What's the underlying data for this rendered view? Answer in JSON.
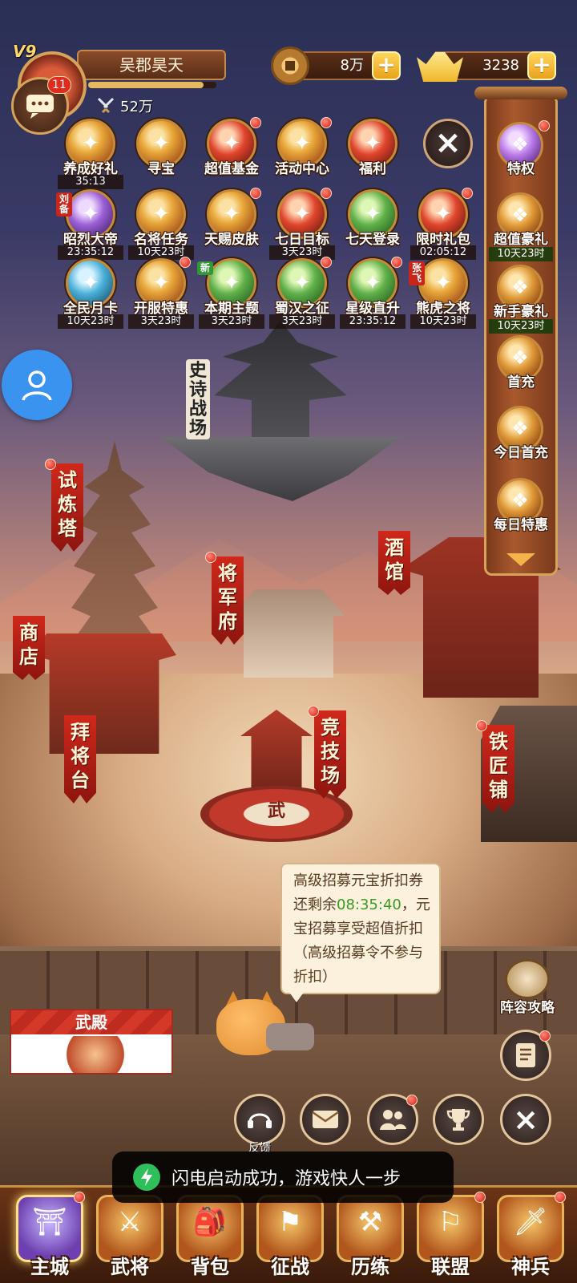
{
  "player": {
    "vip": "V9",
    "name": "吴郡昊天",
    "power": "52万",
    "exp_fraction": 0.9,
    "chat_badge": "11"
  },
  "currency": {
    "copper": "8万",
    "gold": "3238"
  },
  "activities": [
    {
      "label": "养成好礼",
      "timer": "35:13",
      "icon": "gift-icon",
      "color": "orange"
    },
    {
      "label": "寻宝",
      "timer": "",
      "icon": "compass-icon",
      "color": "orange"
    },
    {
      "label": "超值基金",
      "timer": "",
      "icon": "fund-icon",
      "color": "red"
    },
    {
      "label": "活动中心",
      "timer": "",
      "icon": "chest-icon",
      "color": "orange"
    },
    {
      "label": "福利",
      "timer": "",
      "icon": "welfare-icon",
      "color": "red"
    },
    {
      "label": "昭烈大帝",
      "timer": "23:35:12",
      "icon": "hero-icon",
      "color": "purple",
      "tag": "刘备"
    },
    {
      "label": "名将任务",
      "timer": "10天23时",
      "icon": "scroll-icon",
      "color": "orange"
    },
    {
      "label": "天赐皮肤",
      "timer": "",
      "icon": "skin-icon",
      "color": "orange"
    },
    {
      "label": "七日目标",
      "timer": "3天23时",
      "icon": "gift-box-icon",
      "color": "red"
    },
    {
      "label": "七天登录",
      "timer": "",
      "icon": "login-icon",
      "color": "green"
    },
    {
      "label": "限时礼包",
      "timer": "02:05:12",
      "icon": "limited-gift-icon",
      "color": "red"
    },
    {
      "label": "全民月卡",
      "timer": "10天23时",
      "icon": "month-card-icon",
      "color": "blue"
    },
    {
      "label": "开服特惠",
      "timer": "3天23时",
      "icon": "sale-icon",
      "color": "orange"
    },
    {
      "label": "本期主题",
      "timer": "3天23时",
      "icon": "theme-icon",
      "color": "green",
      "tag": "新"
    },
    {
      "label": "蜀汉之征",
      "timer": "3天23时",
      "icon": "crossed-swords-icon",
      "color": "green"
    },
    {
      "label": "星级直升",
      "timer": "23:35:12",
      "icon": "star-up-icon",
      "color": "green"
    },
    {
      "label": "熊虎之将",
      "timer": "10天23时",
      "icon": "general-icon",
      "color": "orange",
      "tag": "张飞"
    }
  ],
  "side_panel": [
    {
      "label": "特权",
      "timer": "",
      "icon": "privilege-icon"
    },
    {
      "label": "超值豪礼",
      "timer": "10天23时",
      "icon": "deluxe-gift-icon"
    },
    {
      "label": "新手豪礼",
      "timer": "10天23时",
      "icon": "newbie-gift-icon"
    },
    {
      "label": "首充",
      "timer": "",
      "icon": "first-recharge-icon"
    },
    {
      "label": "今日首充",
      "timer": "",
      "icon": "daily-recharge-icon"
    },
    {
      "label": "每日特惠",
      "timer": "",
      "icon": "daily-deal-icon"
    }
  ],
  "map": {
    "epic_battlefield": "史诗战场",
    "buildings": [
      {
        "label": "试炼塔"
      },
      {
        "label": "将军府"
      },
      {
        "label": "酒馆"
      },
      {
        "label": "商店"
      },
      {
        "label": "拜将台"
      },
      {
        "label": "竞技场"
      },
      {
        "label": "铁匠铺"
      }
    ],
    "arena_emblem": "武"
  },
  "tooltip": {
    "line1": "高级招募元宝折扣券",
    "line2_prefix": "还剩余",
    "countdown": "08:35:40",
    "line2_suffix": "，元",
    "line3": "宝招募享受超值折扣",
    "line4": "（高级招募令不参与",
    "line5": "折扣）"
  },
  "wudian": {
    "title": "武殿"
  },
  "guide": {
    "label": "阵容攻略"
  },
  "round_buttons": {
    "feedback_label": "反馈"
  },
  "toast": {
    "text": "闪电启动成功，游戏快人一步"
  },
  "bottom_nav": [
    {
      "label": "主城",
      "icon": "city-icon",
      "active": true
    },
    {
      "label": "武将",
      "icon": "generals-icon",
      "active": false
    },
    {
      "label": "背包",
      "icon": "bag-icon",
      "active": false
    },
    {
      "label": "征战",
      "icon": "battle-icon",
      "active": false
    },
    {
      "label": "历练",
      "icon": "training-icon",
      "active": false
    },
    {
      "label": "联盟",
      "icon": "alliance-icon",
      "active": false
    },
    {
      "label": "神兵",
      "icon": "divine-weapon-icon",
      "active": false
    }
  ]
}
